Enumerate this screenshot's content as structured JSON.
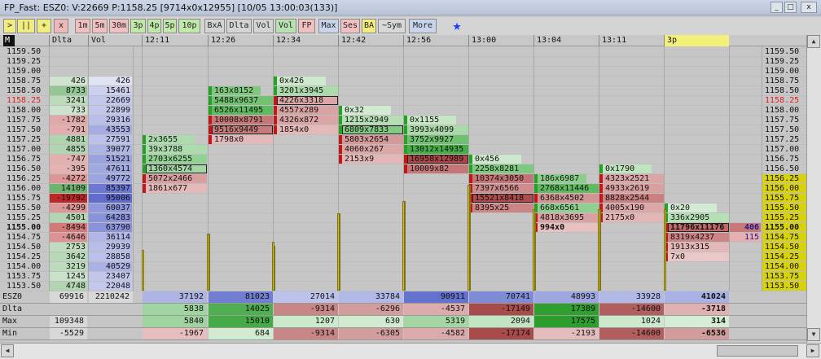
{
  "window": {
    "title": "FP_Fast: ESZ0: V:22669 P:1158.25 [9714x0x12955] [10/05 13:00:03(133)]",
    "min": "_",
    "max": "□",
    "close": "x"
  },
  "toolbar": {
    "buttons": [
      ">",
      "||",
      "+",
      "x",
      "1m",
      "5m",
      "30m",
      "3p",
      "4p",
      "5p",
      "10p",
      "BxA",
      "Dlta",
      "Vol",
      "Vol",
      "FP",
      "Max",
      "Ses",
      "BA",
      "~Sym",
      "More"
    ],
    "star": "★"
  },
  "header": {
    "corner": "M",
    "dlta": "Dlta",
    "vol": "Vol",
    "times": [
      "12:11",
      "12:26",
      "12:34",
      "12:42",
      "12:56",
      "13:00",
      "13:04",
      "13:11",
      "3p"
    ]
  },
  "prices": [
    "1159.50",
    "1159.25",
    "1159.00",
    "1158.75",
    "1158.50",
    "1158.25",
    "1158.00",
    "1157.75",
    "1157.50",
    "1157.25",
    "1157.00",
    "1156.75",
    "1156.50",
    "1156.25",
    "1156.00",
    "1155.75",
    "1155.50",
    "1155.25",
    "1155.00",
    "1154.75",
    "1154.50",
    "1154.25",
    "1154.00",
    "1153.75",
    "1153.50"
  ],
  "current_price": "1158.25",
  "profile": {
    "dlta": [
      "",
      "",
      "",
      "426",
      "8733",
      "3241",
      "733",
      "-1782",
      "-791",
      "4881",
      "4855",
      "-747",
      "-395",
      "-4272",
      "14109",
      "-19792",
      "-4299",
      "4501",
      "-8494",
      "-4646",
      "2753",
      "3642",
      "3219",
      "1245",
      "4748"
    ],
    "vol": [
      "",
      "",
      "",
      "426",
      "15461",
      "22669",
      "22899",
      "29316",
      "43553",
      "27591",
      "39077",
      "51521",
      "47611",
      "49772",
      "85397",
      "95006",
      "60037",
      "64283",
      "63790",
      "36114",
      "29939",
      "28858",
      "40529",
      "23407",
      "22048"
    ]
  },
  "footprint": [
    {
      "label": "12:11",
      "cells": [
        [
          "1157.25",
          "2x3655"
        ],
        [
          "1157.00",
          "39x3788"
        ],
        [
          "1156.75",
          "2703x6255"
        ],
        [
          "1156.50",
          "1360x4574"
        ],
        [
          "1156.25",
          "5072x2466"
        ],
        [
          "1156.00",
          "1861x677"
        ]
      ]
    },
    {
      "label": "12:26",
      "cells": [
        [
          "1158.50",
          "163x8152"
        ],
        [
          "1158.25",
          "5488x9637"
        ],
        [
          "1158.00",
          "6526x11495"
        ],
        [
          "1157.75",
          "10008x8791"
        ],
        [
          "1157.50",
          "9516x9449"
        ],
        [
          "1157.25",
          "1798x0"
        ]
      ]
    },
    {
      "label": "12:34",
      "cells": [
        [
          "1158.75",
          "0x426"
        ],
        [
          "1158.50",
          "3201x3945"
        ],
        [
          "1158.25",
          "4226x3318"
        ],
        [
          "1158.00",
          "4557x289"
        ],
        [
          "1157.75",
          "4326x872"
        ],
        [
          "1157.50",
          "1854x0"
        ]
      ]
    },
    {
      "label": "12:42",
      "cells": [
        [
          "1158.00",
          "0x32"
        ],
        [
          "1157.75",
          "1215x2949"
        ],
        [
          "1157.50",
          "6809x7833"
        ],
        [
          "1157.25",
          "5803x2654"
        ],
        [
          "1157.00",
          "4060x267"
        ],
        [
          "1156.75",
          "2153x9"
        ]
      ]
    },
    {
      "label": "12:56",
      "cells": [
        [
          "1157.75",
          "0x1155"
        ],
        [
          "1157.50",
          "3993x4099"
        ],
        [
          "1157.25",
          "3752x9927"
        ],
        [
          "1157.00",
          "13012x14935"
        ],
        [
          "1156.75",
          "16958x12989"
        ],
        [
          "1156.50",
          "10009x82"
        ]
      ]
    },
    {
      "label": "13:00",
      "cells": [
        [
          "1156.75",
          "0x456"
        ],
        [
          "1156.50",
          "2258x8281"
        ],
        [
          "1156.25",
          "10374x3050"
        ],
        [
          "1156.00",
          "7397x6566"
        ],
        [
          "1155.75",
          "15521x8418"
        ],
        [
          "1155.50",
          "8395x25"
        ]
      ]
    },
    {
      "label": "13:04",
      "cells": [
        [
          "1156.25",
          "186x6987"
        ],
        [
          "1156.00",
          "2768x11446"
        ],
        [
          "1155.75",
          "6368x4502"
        ],
        [
          "1155.50",
          "668x6561"
        ],
        [
          "1155.25",
          "4818x3695"
        ],
        [
          "1155.00",
          "994x0"
        ]
      ]
    },
    {
      "label": "13:11",
      "cells": [
        [
          "1156.50",
          "0x1790"
        ],
        [
          "1156.25",
          "4323x2521"
        ],
        [
          "1156.00",
          "4933x2619"
        ],
        [
          "1155.75",
          "8828x2544"
        ],
        [
          "1155.50",
          "4005x190"
        ],
        [
          "1155.25",
          "2175x0"
        ]
      ]
    },
    {
      "label": "3p",
      "cells": [
        [
          "1155.50",
          "0x20"
        ],
        [
          "1155.25",
          "336x2905"
        ],
        [
          "1155.00",
          "11796x11176"
        ],
        [
          "1154.75",
          "8319x4237"
        ],
        [
          "1154.50",
          "1913x315"
        ],
        [
          "1154.25",
          "7x0"
        ]
      ]
    }
  ],
  "right_values": [
    "406",
    "115"
  ],
  "bottom": {
    "labels": [
      "ESZ0",
      "Dlta",
      "Max",
      "Min"
    ],
    "profile": [
      [
        "69916",
        "2210242"
      ],
      [
        "",
        ""
      ],
      [
        "109348",
        ""
      ],
      [
        "-5529",
        ""
      ]
    ],
    "esz0": [
      "37192",
      "81023",
      "27014",
      "33784",
      "90911",
      "70741",
      "48993",
      "33928",
      "41024"
    ],
    "dlta": [
      "5838",
      "14025",
      "-9314",
      "-6296",
      "-4537",
      "-17149",
      "17389",
      "-14600",
      "-3718"
    ],
    "max": [
      "5840",
      "15010",
      "1207",
      "630",
      "5319",
      "2094",
      "17575",
      "1024",
      "314"
    ],
    "min": [
      "-1967",
      "684",
      "-9314",
      "-6305",
      "-4582",
      "-17174",
      "-2193",
      "-14600",
      "-6536"
    ]
  },
  "colors": {
    "ask": "#4aa84a",
    "bid": "#c04848",
    "highlight": "#e2dc30",
    "current": "#e02020",
    "vol": "#6878c8"
  }
}
